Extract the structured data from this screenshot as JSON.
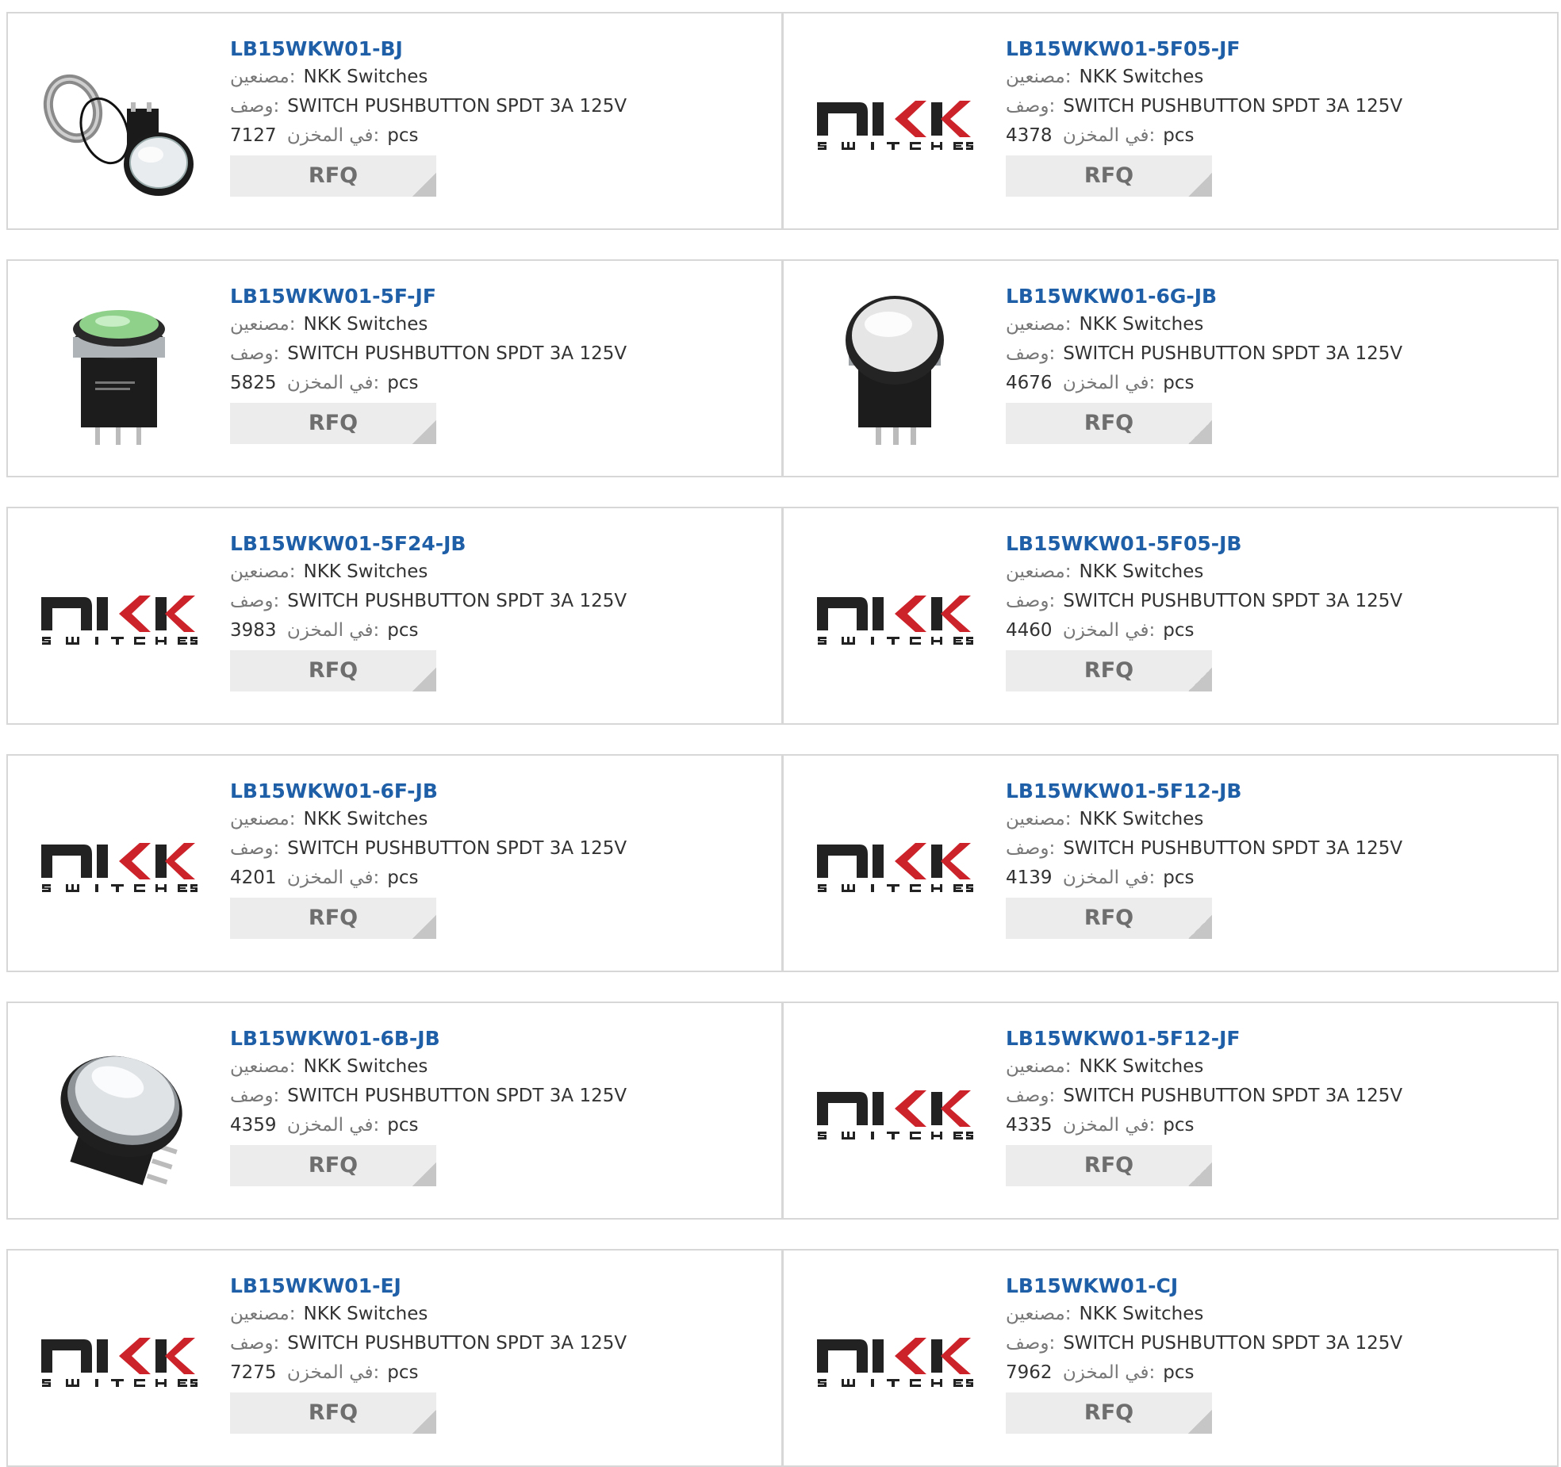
{
  "labels": {
    "manufacturer": "مصنعين:",
    "description": "وصف:",
    "in_stock": "في المخزن:",
    "pcs": "pcs",
    "rfq": "RFQ"
  },
  "logo": {
    "brand": "nkk",
    "caption": "SWITCHES",
    "brand_color": "#cc2229"
  },
  "products": [
    {
      "part_number": "LB15WKW01-BJ",
      "manufacturer": "NKK Switches",
      "description": "SWITCH PUSHBUTTON SPDT 3A 125V",
      "stock": "7127",
      "image": "pushbutton-with-nut-photo"
    },
    {
      "part_number": "LB15WKW01-5F05-JF",
      "manufacturer": "NKK Switches",
      "description": "SWITCH PUSHBUTTON SPDT 3A 125V",
      "stock": "4378",
      "image": "nkk-logo"
    },
    {
      "part_number": "LB15WKW01-5F-JF",
      "manufacturer": "NKK Switches",
      "description": "SWITCH PUSHBUTTON SPDT 3A 125V",
      "stock": "5825",
      "image": "green-pushbutton-photo"
    },
    {
      "part_number": "LB15WKW01-6G-JB",
      "manufacturer": "NKK Switches",
      "description": "SWITCH PUSHBUTTON SPDT 3A 125V",
      "stock": "4676",
      "image": "white-pushbutton-photo"
    },
    {
      "part_number": "LB15WKW01-5F24-JB",
      "manufacturer": "NKK Switches",
      "description": "SWITCH PUSHBUTTON SPDT 3A 125V",
      "stock": "3983",
      "image": "nkk-logo"
    },
    {
      "part_number": "LB15WKW01-5F05-JB",
      "manufacturer": "NKK Switches",
      "description": "SWITCH PUSHBUTTON SPDT 3A 125V",
      "stock": "4460",
      "image": "nkk-logo"
    },
    {
      "part_number": "LB15WKW01-6F-JB",
      "manufacturer": "NKK Switches",
      "description": "SWITCH PUSHBUTTON SPDT 3A 125V",
      "stock": "4201",
      "image": "nkk-logo"
    },
    {
      "part_number": "LB15WKW01-5F12-JB",
      "manufacturer": "NKK Switches",
      "description": "SWITCH PUSHBUTTON SPDT 3A 125V",
      "stock": "4139",
      "image": "nkk-logo"
    },
    {
      "part_number": "LB15WKW01-6B-JB",
      "manufacturer": "NKK Switches",
      "description": "SWITCH PUSHBUTTON SPDT 3A 125V",
      "stock": "4359",
      "image": "angled-pushbutton-photo"
    },
    {
      "part_number": "LB15WKW01-5F12-JF",
      "manufacturer": "NKK Switches",
      "description": "SWITCH PUSHBUTTON SPDT 3A 125V",
      "stock": "4335",
      "image": "nkk-logo"
    },
    {
      "part_number": "LB15WKW01-EJ",
      "manufacturer": "NKK Switches",
      "description": "SWITCH PUSHBUTTON SPDT 3A 125V",
      "stock": "7275",
      "image": "nkk-logo"
    },
    {
      "part_number": "LB15WKW01-CJ",
      "manufacturer": "NKK Switches",
      "description": "SWITCH PUSHBUTTON SPDT 3A 125V",
      "stock": "7962",
      "image": "nkk-logo"
    }
  ]
}
